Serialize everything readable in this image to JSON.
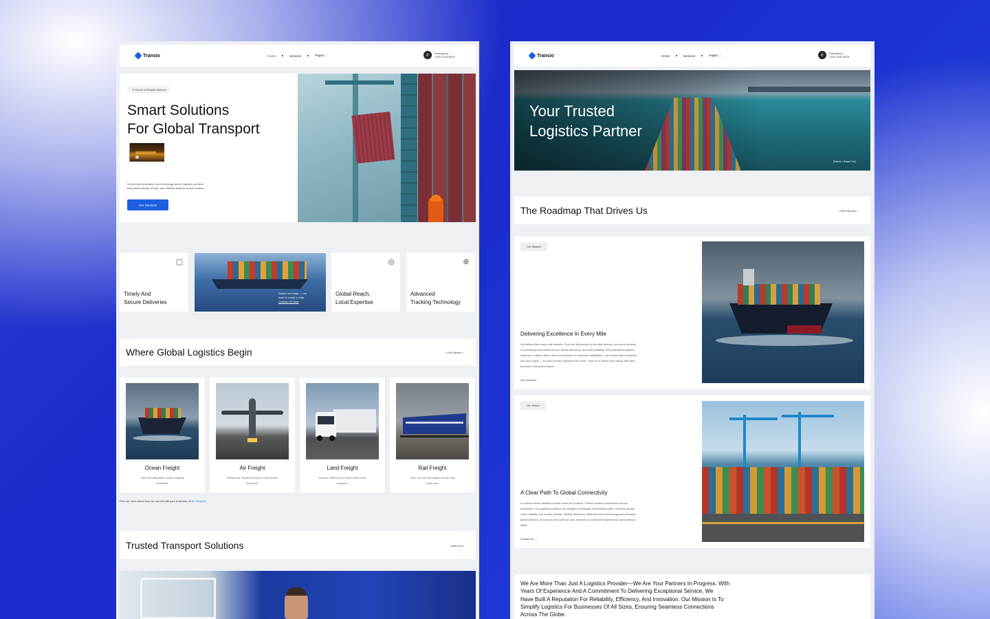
{
  "left": {
    "nav": {
      "logo": "Transio",
      "menu": [
        "Home",
        "Services",
        "Pages"
      ],
      "emergency_label": "Emergency",
      "phone": "+220 1234 5678"
    },
    "hero": {
      "pill": "Secure & Reliable Delivery",
      "title_line1": "Smart Solutions",
      "title_line2": "For Global Transport",
      "desc_line1": "We provide innovative and technology-driven logistics services",
      "desc_line2": "that ensure timely, secure, and efficient delivery across borders.",
      "button": "Our Services"
    },
    "features": [
      {
        "label_line1": "Timely And",
        "label_line2": "Secure Deliveries",
        "icon": "package-icon"
      },
      {
        "overlay_line1": "Reach out today — our",
        "overlay_line2": "team is ready to help.",
        "overlay_link": "Contact US Now"
      },
      {
        "label_line1": "Global Reach,",
        "label_line2": "Local Expertise",
        "icon": "globe-icon"
      },
      {
        "label_line1": "Advanced",
        "label_line2": "Tracking Technology",
        "icon": "tracking-icon"
      }
    ],
    "section1": {
      "title": "Where Global Logistics Begin",
      "link": "• Our Service •"
    },
    "services": [
      {
        "title": "Ocean Freight",
        "desc_line1": "Safe and affordable ocean shipping",
        "desc_line2": "worldwide."
      },
      {
        "title": "Air Freight",
        "desc_line1": "Efficient air freight services to meet global",
        "desc_line2": "demands."
      },
      {
        "title": "Land Freight",
        "desc_line1": "Smooth, efficient and trusted land route",
        "desc_line2": "transport."
      },
      {
        "title": "Rail Freight",
        "desc_line1": "Fast, eco-friendly freight across long",
        "desc_line2": "distances."
      }
    ],
    "more": {
      "text": "Find out more about how we can elevate your business.",
      "link": "More Services"
    },
    "section2": {
      "title": "Trusted Transport Solutions",
      "link": "• About Us •"
    }
  },
  "right": {
    "nav": {
      "logo": "Transio",
      "menu": [
        "Home",
        "Services",
        "Pages"
      ],
      "emergency_label": "Emergency",
      "phone": "+220 1234 5678"
    },
    "hero": {
      "title_line1": "Your Trusted",
      "title_line2": "Logistics Partner",
      "breadcrumb": "[Home / About Us]"
    },
    "roadmap": {
      "title": "The Roadmap That Drives Us",
      "link": "• Who We Are •"
    },
    "mission": {
      "tag": "Our Mission",
      "title": "Delivering Excellence In Every Mile",
      "lines": [
        "We believe that every mile matters. From the first pickup to the final delivery, our focus remains",
        "on providing exceptional service, timely execution, and total reliability. With advanced logistics",
        "solutions, a skilled team, and a commitment to customer satisfaction, we ensure that excellence",
        "isn't just a goal — it's part of every shipment we move. Trust us to deliver your cargo with care,",
        "precision, and performance."
      ],
      "link": "Our Services →"
    },
    "vision": {
      "tag": "Our Vision",
      "title": "A Clear Path To Global Connectivity",
      "lines": [
        "In a world where distance should never be a barrier, Transio creates connections across",
        "continents. Our logistics solutions are designed to simplify international trade, enhance supply",
        "chain visibility, and ensure smooth, reliable deliveries. With advanced technology and a trusted",
        "global network, we pave a clear path for your business to reach new markets and grow without",
        "limits."
      ],
      "link": "Contact us →"
    },
    "about": {
      "lines": [
        "We Are More Than Just A Logistics Provider—We Are Your Partners In Progress. With",
        "Years Of Experience And A Commitment To Delivering Exceptional Service, We",
        "Have Built A Reputation For Reliability, Efficiency, And Innovation. Our Mission Is To",
        "Simplify Logistics For Businesses Of All Sizes, Ensuring Seamless Connections",
        "Across The Globe."
      ]
    }
  }
}
